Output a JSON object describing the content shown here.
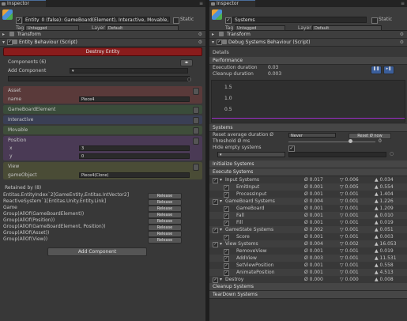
{
  "left": {
    "tab_title": "Inspector",
    "header": {
      "name": "Entity_0 (false): GameBoard(Element), Interactive, Movable, Position, View",
      "static_label": "Static",
      "tag_label": "Tag",
      "tag_value": "Untagged",
      "layer_label": "Layer",
      "layer_value": "Default"
    },
    "transform_label": "Transform",
    "component_title": "Entity Behaviour (Script)",
    "destroy_label": "Destroy Entity",
    "components_label": "Components (6)",
    "add_component_label": "Add Component",
    "sections": {
      "asset": {
        "title": "Asset",
        "field_label": "name",
        "field_value": "Piece4"
      },
      "gameboard": {
        "title": "GameBoardElement"
      },
      "interactive": {
        "title": "Interactive"
      },
      "movable": {
        "title": "Movable"
      },
      "position": {
        "title": "Position",
        "x_label": "x",
        "x_value": "3",
        "y_label": "y",
        "y_value": "0"
      },
      "view": {
        "title": "View",
        "field_label": "gameObject",
        "field_value": "Piece4(Clone)"
      }
    },
    "retained_label": "Retained by (8)",
    "release_label": "Release",
    "retained": [
      "Entitas.EntityIndex`2[GameEntity,Entitas.IntVector2]",
      "ReactiveSystem`1[Entitas.Unity.Entity.Link]",
      "Game",
      "Group(AllOf(GameBoardElement))",
      "Group(AllOf(Position))",
      "Group(AllOf(GameBoardElement, Position))",
      "Group(AllOf(Asset))",
      "Group(AllOf(View))"
    ],
    "add_component_button": "Add Component"
  },
  "right": {
    "tab_title": "Inspector",
    "header": {
      "name": "Systems",
      "static_label": "Static",
      "tag_label": "Tag",
      "tag_value": "Untagged",
      "layer_label": "Layer",
      "layer_value": "Default"
    },
    "transform_label": "Transform",
    "component_title": "Debug Systems Behaviour (Script)",
    "details_label": "Details",
    "performance_label": "Performance",
    "execution_label": "Execution duration",
    "execution_value": "0.03",
    "cleanup_label": "Cleanup duration",
    "cleanup_value": "0.003",
    "graph_labels": [
      "1.5",
      "1.0",
      "0.5"
    ],
    "systems_label": "Systems",
    "reset_label": "Reset average duration Ø",
    "reset_value": "Never",
    "reset_button": "Reset Ø now",
    "threshold_label": "Threshold Ø ms",
    "threshold_value": "0",
    "hide_empty_label": "Hide empty systems",
    "init_label": "Initialize Systems",
    "execute_label": "Execute Systems",
    "cleanup_systems_label": "Cleanup Systems",
    "teardown_label": "TearDown Systems",
    "systems": [
      {
        "name": "Input Systems",
        "indent": 1,
        "a": "Ø 0.017",
        "b": "▽ 0.006",
        "c": "▲ 0.034"
      },
      {
        "name": "EmitInput",
        "indent": 2,
        "a": "Ø 0.001",
        "b": "▽ 0.005",
        "c": "▲ 0.554"
      },
      {
        "name": "ProcessInput",
        "indent": 2,
        "a": "Ø 0.001",
        "b": "▽ 0.001",
        "c": "▲ 1.404"
      },
      {
        "name": "GameBoard Systems",
        "indent": 1,
        "a": "Ø 0.004",
        "b": "▽ 0.001",
        "c": "▲ 1.226"
      },
      {
        "name": "GameBoard",
        "indent": 2,
        "a": "Ø 0.001",
        "b": "▽ 0.001",
        "c": "▲ 1.209"
      },
      {
        "name": "Fall",
        "indent": 2,
        "a": "Ø 0.001",
        "b": "▽ 0.001",
        "c": "▲ 0.010"
      },
      {
        "name": "Fill",
        "indent": 2,
        "a": "Ø 0.001",
        "b": "▽ 0.001",
        "c": "▲ 0.019"
      },
      {
        "name": "GameState Systems",
        "indent": 1,
        "a": "Ø 0.002",
        "b": "▽ 0.001",
        "c": "▲ 0.051"
      },
      {
        "name": "Score",
        "indent": 2,
        "a": "Ø 0.001",
        "b": "▽ 0.001",
        "c": "▲ 0.003"
      },
      {
        "name": "View Systems",
        "indent": 1,
        "a": "Ø 0.004",
        "b": "▽ 0.002",
        "c": "▲ 16.053"
      },
      {
        "name": "RemoveView",
        "indent": 2,
        "a": "Ø 0.001",
        "b": "▽ 0.001",
        "c": "▲ 0.019"
      },
      {
        "name": "AddView",
        "indent": 2,
        "a": "Ø 0.003",
        "b": "▽ 0.001",
        "c": "▲ 11.531"
      },
      {
        "name": "SetViewPosition",
        "indent": 2,
        "a": "Ø 0.001",
        "b": "▽ 0.001",
        "c": "▲ 0.558"
      },
      {
        "name": "AnimatePosition",
        "indent": 2,
        "a": "Ø 0.001",
        "b": "▽ 0.001",
        "c": "▲ 4.513"
      },
      {
        "name": "Destroy",
        "indent": 1,
        "a": "Ø 0.000",
        "b": "▽ 0.000",
        "c": "▲ 0.008"
      }
    ]
  },
  "colors": {
    "destroy": "#8a1c1c",
    "asset": "#5a3a3a",
    "gameboard": "#3a4c3a",
    "interactive": "#3a3f55",
    "movable": "#3f4e3a",
    "position": "#4a3a55",
    "view": "#4a4c36",
    "graph_line": "#9c2ec9"
  }
}
